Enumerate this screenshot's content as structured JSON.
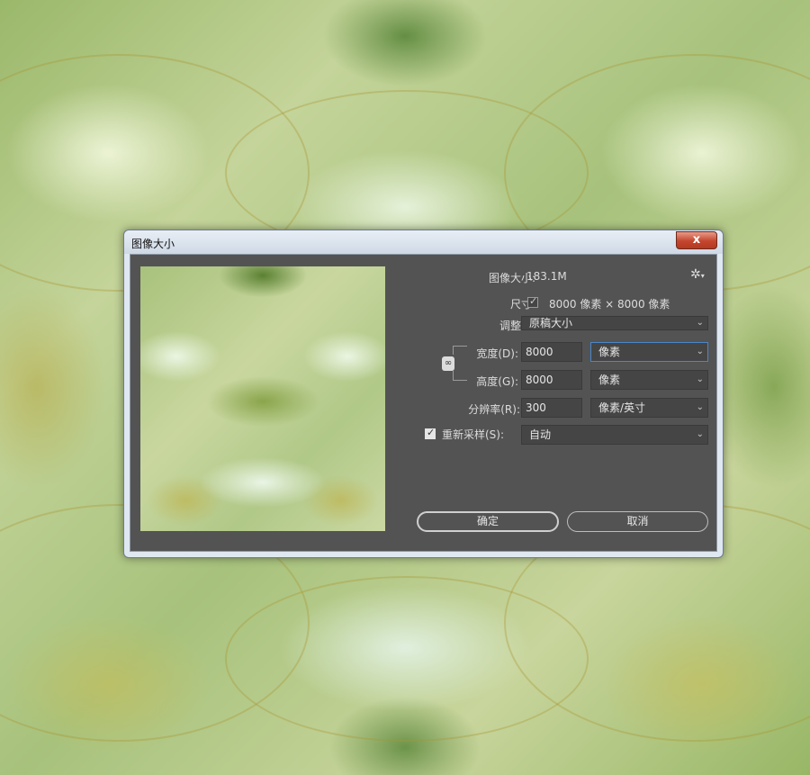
{
  "dialog": {
    "title": "图像大小",
    "close_label": "x"
  },
  "info": {
    "image_size_label": "图像大小:",
    "image_size_value": "183.1M",
    "dimensions_label": "尺寸:",
    "dimensions_value": "8000 像素 × 8000 像素",
    "fit_to_label": "调整为:",
    "fit_to_value": "原稿大小"
  },
  "width": {
    "label": "宽度(D):",
    "value": "8000",
    "unit": "像素"
  },
  "height": {
    "label": "高度(G):",
    "value": "8000",
    "unit": "像素"
  },
  "resolution": {
    "label": "分辨率(R):",
    "value": "300",
    "unit": "像素/英寸"
  },
  "resample": {
    "label": "重新采样(S):",
    "value": "自动",
    "checked": true
  },
  "buttons": {
    "ok": "确定",
    "cancel": "取消"
  },
  "icons": {
    "close": "close-icon",
    "settings": "gear-icon",
    "link": "chain-link-icon",
    "dropdown": "chevron-down-icon",
    "check": "checkmark-icon"
  },
  "colors": {
    "panel": "#535353",
    "field": "#454545",
    "focus": "#4a86c8",
    "close": "#c4452d"
  }
}
